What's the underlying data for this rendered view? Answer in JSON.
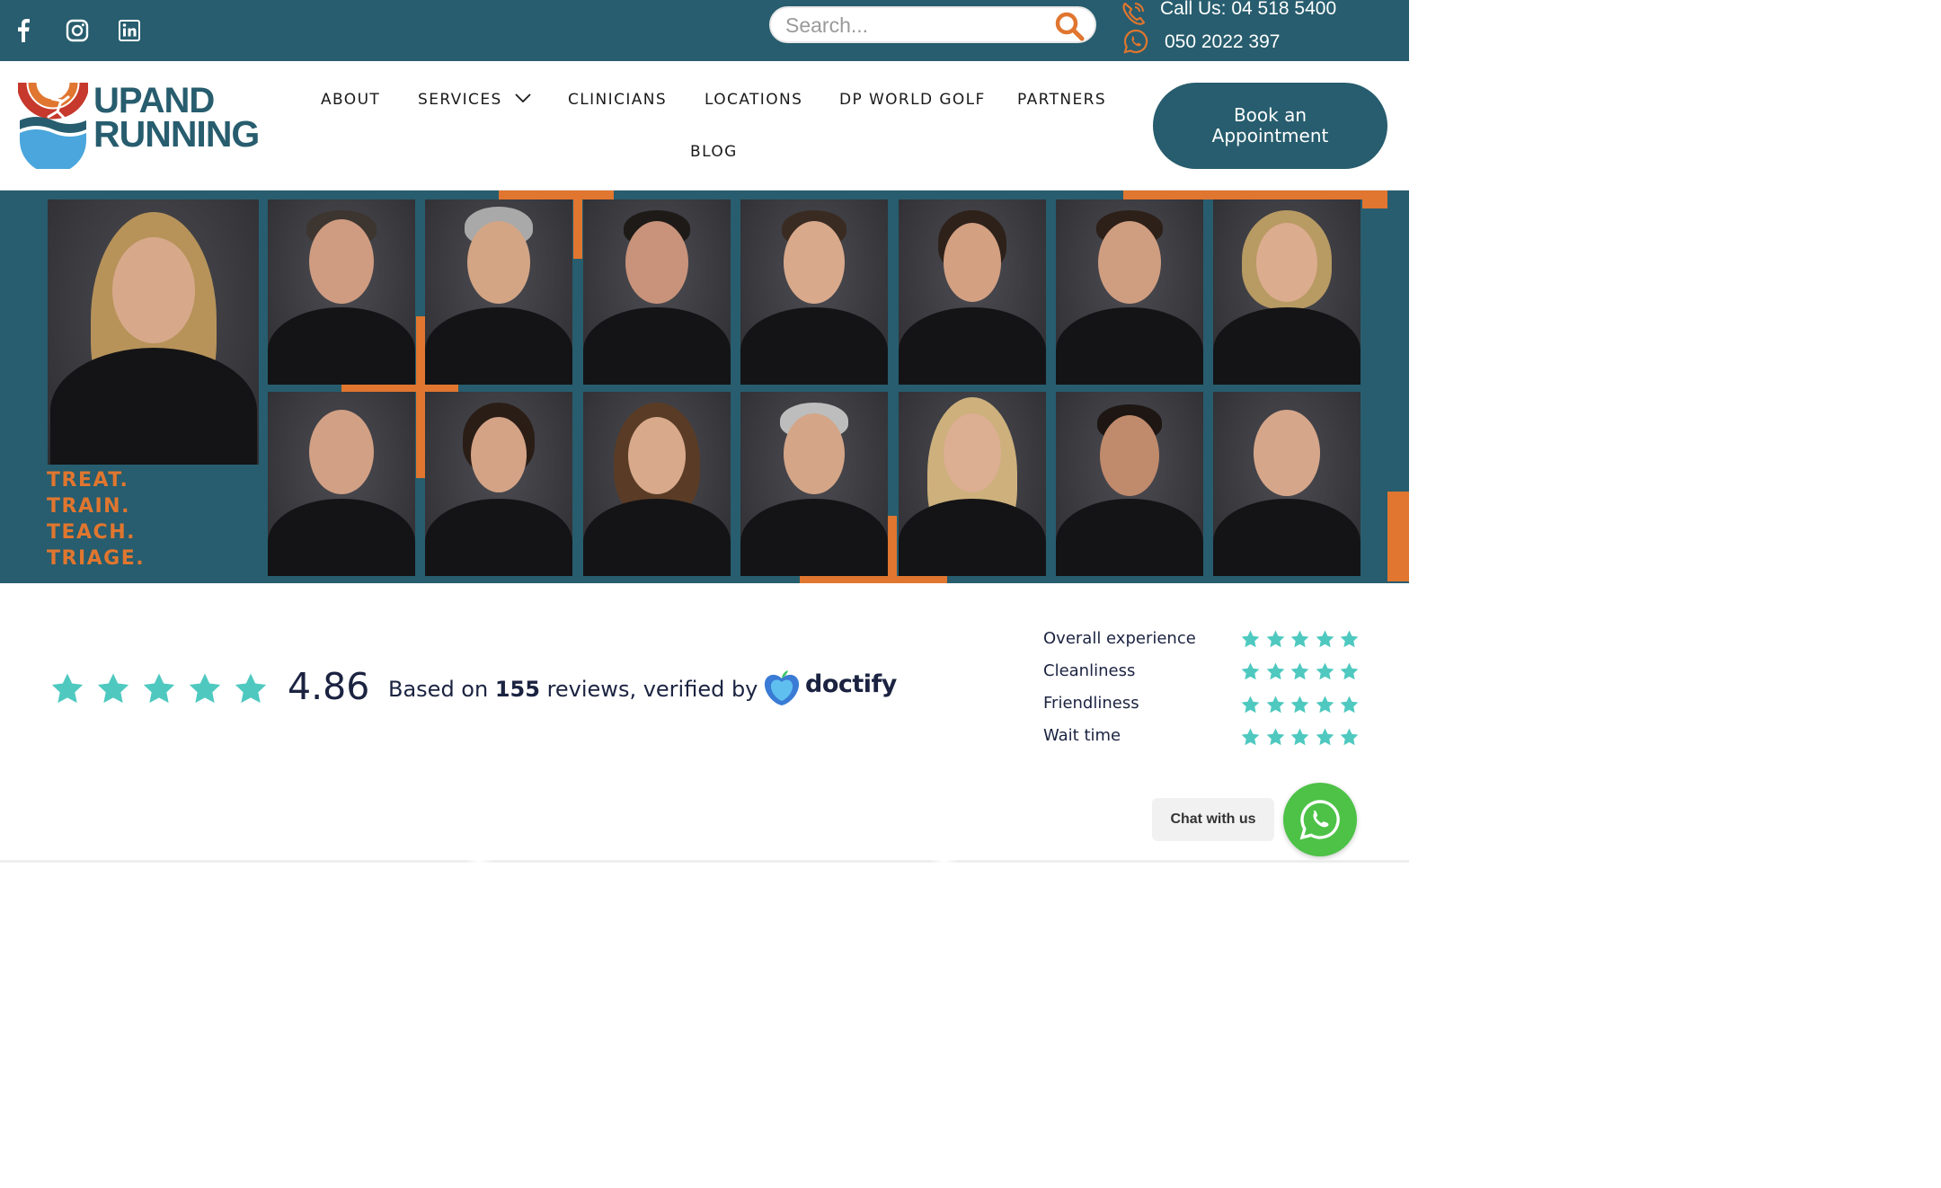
{
  "topbar": {
    "social": [
      {
        "name": "facebook",
        "icon": "facebook-icon"
      },
      {
        "name": "instagram",
        "icon": "instagram-icon"
      },
      {
        "name": "linkedin",
        "icon": "linkedin-icon"
      }
    ],
    "search": {
      "placeholder": "Search...",
      "icon": "search-icon"
    },
    "call_label": "Call Us: 04 518 5400",
    "whatsapp_number": "050 2022 397",
    "accent_color": "#e0762f",
    "bar_color": "#275d6e"
  },
  "header": {
    "logo": {
      "line1": "UPAND",
      "line2": "RUNNING"
    },
    "nav": [
      "ABOUT",
      "SERVICES",
      "CLINICIANS",
      "LOCATIONS",
      "DP WORLD GOLF",
      "PARTNERS",
      "BLOG"
    ],
    "book_button": {
      "line1": "Book an",
      "line2": "Appointment"
    }
  },
  "hero": {
    "slogan": [
      "TREAT.",
      "TRAIN.",
      "TEACH.",
      "TRIAGE."
    ]
  },
  "ratings": {
    "score": "4.86",
    "text_prefix": "Based on ",
    "review_count": "155",
    "text_suffix": " reviews, verified by",
    "provider": "doctify",
    "star_color": "#4fc9c0",
    "categories": [
      {
        "label": "Overall experience",
        "stars": 5
      },
      {
        "label": "Cleanliness",
        "stars": 5
      },
      {
        "label": "Friendliness",
        "stars": 5
      },
      {
        "label": "Wait time",
        "stars": 5
      }
    ]
  },
  "chat": {
    "label": "Chat with us",
    "icon": "whatsapp-icon",
    "color": "#4dc247"
  }
}
